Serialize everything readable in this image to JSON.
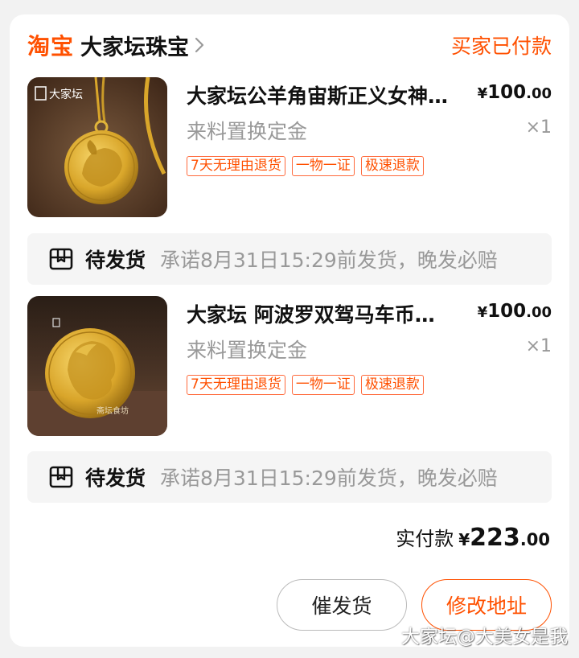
{
  "shop": {
    "platform": "淘宝",
    "name": "大家坛珠宝",
    "order_status": "买家已付款"
  },
  "items": [
    {
      "title": "大家坛公羊角宙斯正义女神…",
      "price_currency": "¥",
      "price_int": "100",
      "price_dec": ".00",
      "sku": "来料置换定金",
      "qty": "×1",
      "tags": [
        "7天无理由退货",
        "一物一证",
        "极速退款"
      ],
      "image_label": "大家坛"
    },
    {
      "title": "大家坛 阿波罗双驾马车币…",
      "price_currency": "¥",
      "price_int": "100",
      "price_dec": ".00",
      "sku": "来料置换定金",
      "qty": "×1",
      "tags": [
        "7天无理由退货",
        "一物一证",
        "极速退款"
      ],
      "image_label": "回"
    }
  ],
  "shipping": [
    {
      "status": "待发货",
      "note": "承诺8月31日15:29前发货，晚发必赔"
    },
    {
      "status": "待发货",
      "note": "承诺8月31日15:29前发货，晚发必赔"
    }
  ],
  "total": {
    "label": "实付款",
    "currency": "¥",
    "int": "223",
    "dec": ".00"
  },
  "buttons": {
    "urge": "催发货",
    "address": "修改地址"
  },
  "watermark": "大家坛@大美女是我",
  "colors": {
    "accent": "#ff5000",
    "gold": "#e0b43a"
  }
}
